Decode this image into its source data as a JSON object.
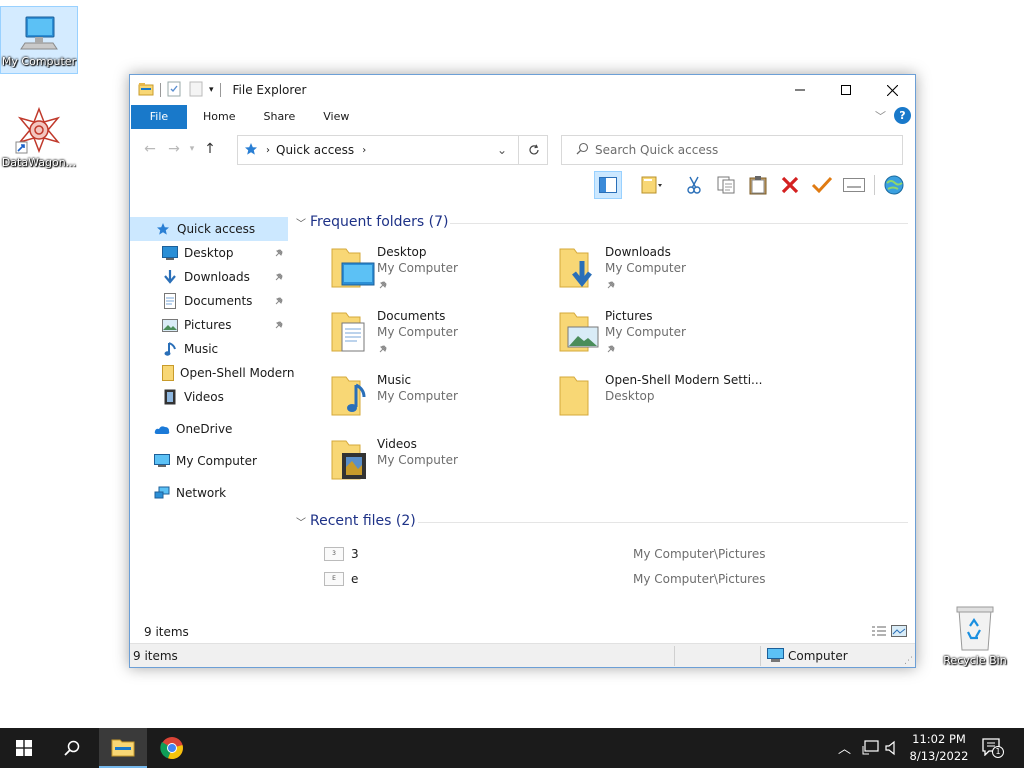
{
  "desktop": {
    "icons": [
      {
        "label": "My Computer"
      },
      {
        "label": "DataWagon..."
      },
      {
        "label": "Recycle Bin"
      }
    ]
  },
  "window": {
    "title": "File Explorer",
    "ribbon_tabs": [
      "File",
      "Home",
      "Share",
      "View"
    ],
    "help_label": "?",
    "address": {
      "location": "Quick access"
    },
    "search": {
      "placeholder": "Search Quick access"
    }
  },
  "nav": {
    "quick_access": "Quick access",
    "pinned": [
      "Desktop",
      "Downloads",
      "Documents",
      "Pictures"
    ],
    "others": [
      "Music",
      "Open-Shell Modern",
      "Videos"
    ],
    "onedrive": "OneDrive",
    "my_computer": "My Computer",
    "network": "Network"
  },
  "content": {
    "frequent_header": "Frequent folders (7)",
    "folders": [
      {
        "name": "Desktop",
        "location": "My Computer",
        "pinned": true
      },
      {
        "name": "Downloads",
        "location": "My Computer",
        "pinned": true
      },
      {
        "name": "Documents",
        "location": "My Computer",
        "pinned": true
      },
      {
        "name": "Pictures",
        "location": "My Computer",
        "pinned": true
      },
      {
        "name": "Music",
        "location": "My Computer",
        "pinned": false
      },
      {
        "name": "Open-Shell Modern Setti...",
        "location": "Desktop",
        "pinned": false
      },
      {
        "name": "Videos",
        "location": "My Computer",
        "pinned": false
      }
    ],
    "recent_header": "Recent files (2)",
    "recent_files": [
      {
        "name": "3",
        "path": "My Computer\\Pictures",
        "thumb": "3"
      },
      {
        "name": "e",
        "path": "My Computer\\Pictures",
        "thumb": "E"
      }
    ]
  },
  "status": {
    "items_upper": "9 items",
    "items_lower": "9 items",
    "location": "Computer"
  },
  "taskbar": {
    "time": "11:02 PM",
    "date": "8/13/2022",
    "notification_count": "1"
  },
  "colors": {
    "accent": "#1979ca",
    "selection": "#cce8ff",
    "group_header": "#1e3287",
    "taskbar": "#1b1b1b",
    "folder": "#f8d775"
  }
}
